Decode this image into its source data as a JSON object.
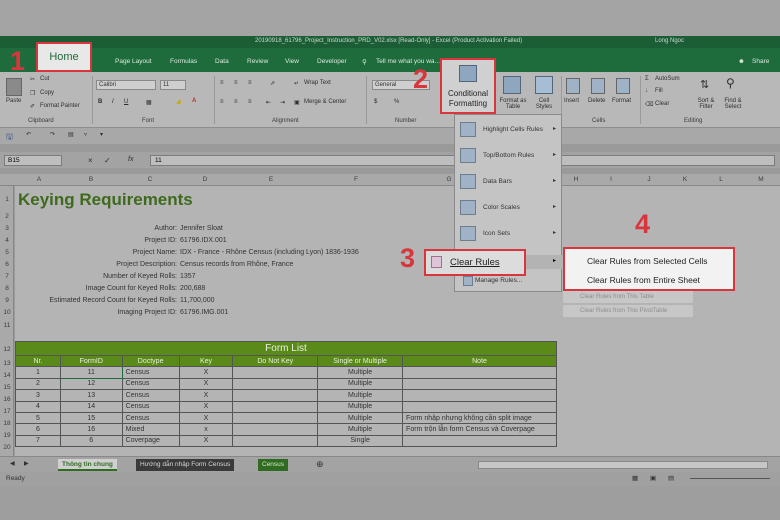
{
  "window": {
    "title": "20190918_61796_Project_Instruction_PRD_V02.xlsx  [Read-Only] - Excel (Product Activation Failed)",
    "user": "Long Ngoc",
    "share": "Share"
  },
  "tabs": {
    "home": "Home",
    "items": [
      "Page Layout",
      "Formulas",
      "Data",
      "Review",
      "View",
      "Developer"
    ],
    "tell_me": "Tell me what you wa..."
  },
  "ribbon": {
    "paste": "Paste",
    "cut": "Cut",
    "copy": "Copy",
    "format_painter": "Format Painter",
    "clipboard": "Clipboard",
    "font_name": "Calibri",
    "font_size": "11",
    "font_group": "Font",
    "wrap_text": "Wrap Text",
    "merge_center": "Merge & Center",
    "alignment": "Alignment",
    "number_format": "General",
    "number": "Number",
    "conditional_formatting": "Conditional Formatting",
    "format_as_table": "Format as Table",
    "cell_styles": "Cell Styles",
    "insert": "Insert",
    "delete": "Delete",
    "format": "Format",
    "cells": "Cells",
    "autosum": "AutoSum",
    "fill": "Fill",
    "clear": "Clear",
    "sort_filter": "Sort & Filter",
    "find_select": "Find & Select",
    "editing": "Editing"
  },
  "formula_bar": {
    "name_box": "B15",
    "fx": "fx",
    "value": "11"
  },
  "columns": [
    "A",
    "B",
    "C",
    "D",
    "E",
    "F",
    "G",
    "H",
    "I",
    "J",
    "K",
    "L",
    "M"
  ],
  "rows": [
    "1",
    "2",
    "3",
    "4",
    "5",
    "6",
    "7",
    "8",
    "9",
    "10",
    "11",
    "12",
    "13",
    "14",
    "15",
    "16",
    "17",
    "18",
    "19",
    "20",
    "21",
    "22"
  ],
  "sheet": {
    "title": "Keying Requirements",
    "fields": [
      {
        "label": "Author:",
        "value": "Jennifer Sloat"
      },
      {
        "label": "Project ID:",
        "value": "61796.IDX.001"
      },
      {
        "label": "Project Name:",
        "value": "IDX - France - Rhône Census (including Lyon) 1836-1936"
      },
      {
        "label": "Project Description:",
        "value": "Census records from Rhône, France"
      },
      {
        "label": "Number of Keyed Rolls:",
        "value": "1357"
      },
      {
        "label": "Image Count for Keyed Rolls:",
        "value": "200,688"
      },
      {
        "label": "Estimated Record Count for Keyed Rolls:",
        "value": "11,700,000"
      },
      {
        "label": "Imaging Project ID:",
        "value": "61796.IMG.001"
      }
    ],
    "form_list": {
      "title": "Form List",
      "headers": [
        "Nr.",
        "FormID",
        "Doctype",
        "Key",
        "Do Not Key",
        "Single or Multiple",
        "Note"
      ],
      "rows": [
        [
          "1",
          "11",
          "Census",
          "X",
          "",
          "Multiple",
          ""
        ],
        [
          "2",
          "12",
          "Census",
          "X",
          "",
          "Multiple",
          ""
        ],
        [
          "3",
          "13",
          "Census",
          "X",
          "",
          "Multiple",
          ""
        ],
        [
          "4",
          "14",
          "Census",
          "X",
          "",
          "Multiple",
          ""
        ],
        [
          "5",
          "15",
          "Census",
          "X",
          "",
          "Multiple",
          "Form nhập nhưng không cần split image"
        ],
        [
          "6",
          "16",
          "Mixed",
          "x",
          "",
          "Multiple",
          "Form trộn lẫn form Census và Coverpage"
        ],
        [
          "7",
          "6",
          "Coverpage",
          "X",
          "",
          "Single",
          ""
        ]
      ]
    }
  },
  "conditional_menu": {
    "items": [
      "Highlight Cells Rules",
      "Top/Bottom Rules",
      "Data Bars",
      "Color Scales",
      "Icon Sets"
    ],
    "clear_rules": "Clear Rules",
    "manage_rules": "Manage Rules..."
  },
  "clear_submenu": {
    "selected": "Clear Rules from Selected Cells",
    "entire": "Clear Rules from Entire Sheet",
    "this_table": "Clear Rules from This Table",
    "this_pivot": "Clear Rules from This PivotTable"
  },
  "step_numbers": [
    "1",
    "2",
    "3",
    "4"
  ],
  "sheet_tabs": [
    "Thông tin chung",
    "Hướng dẫn nhập Form Census",
    "Census"
  ],
  "status": "Ready",
  "colors": {
    "accent": "#d9353d",
    "excel_green": "#1e6b3c",
    "table_green": "#5a8a1a"
  }
}
